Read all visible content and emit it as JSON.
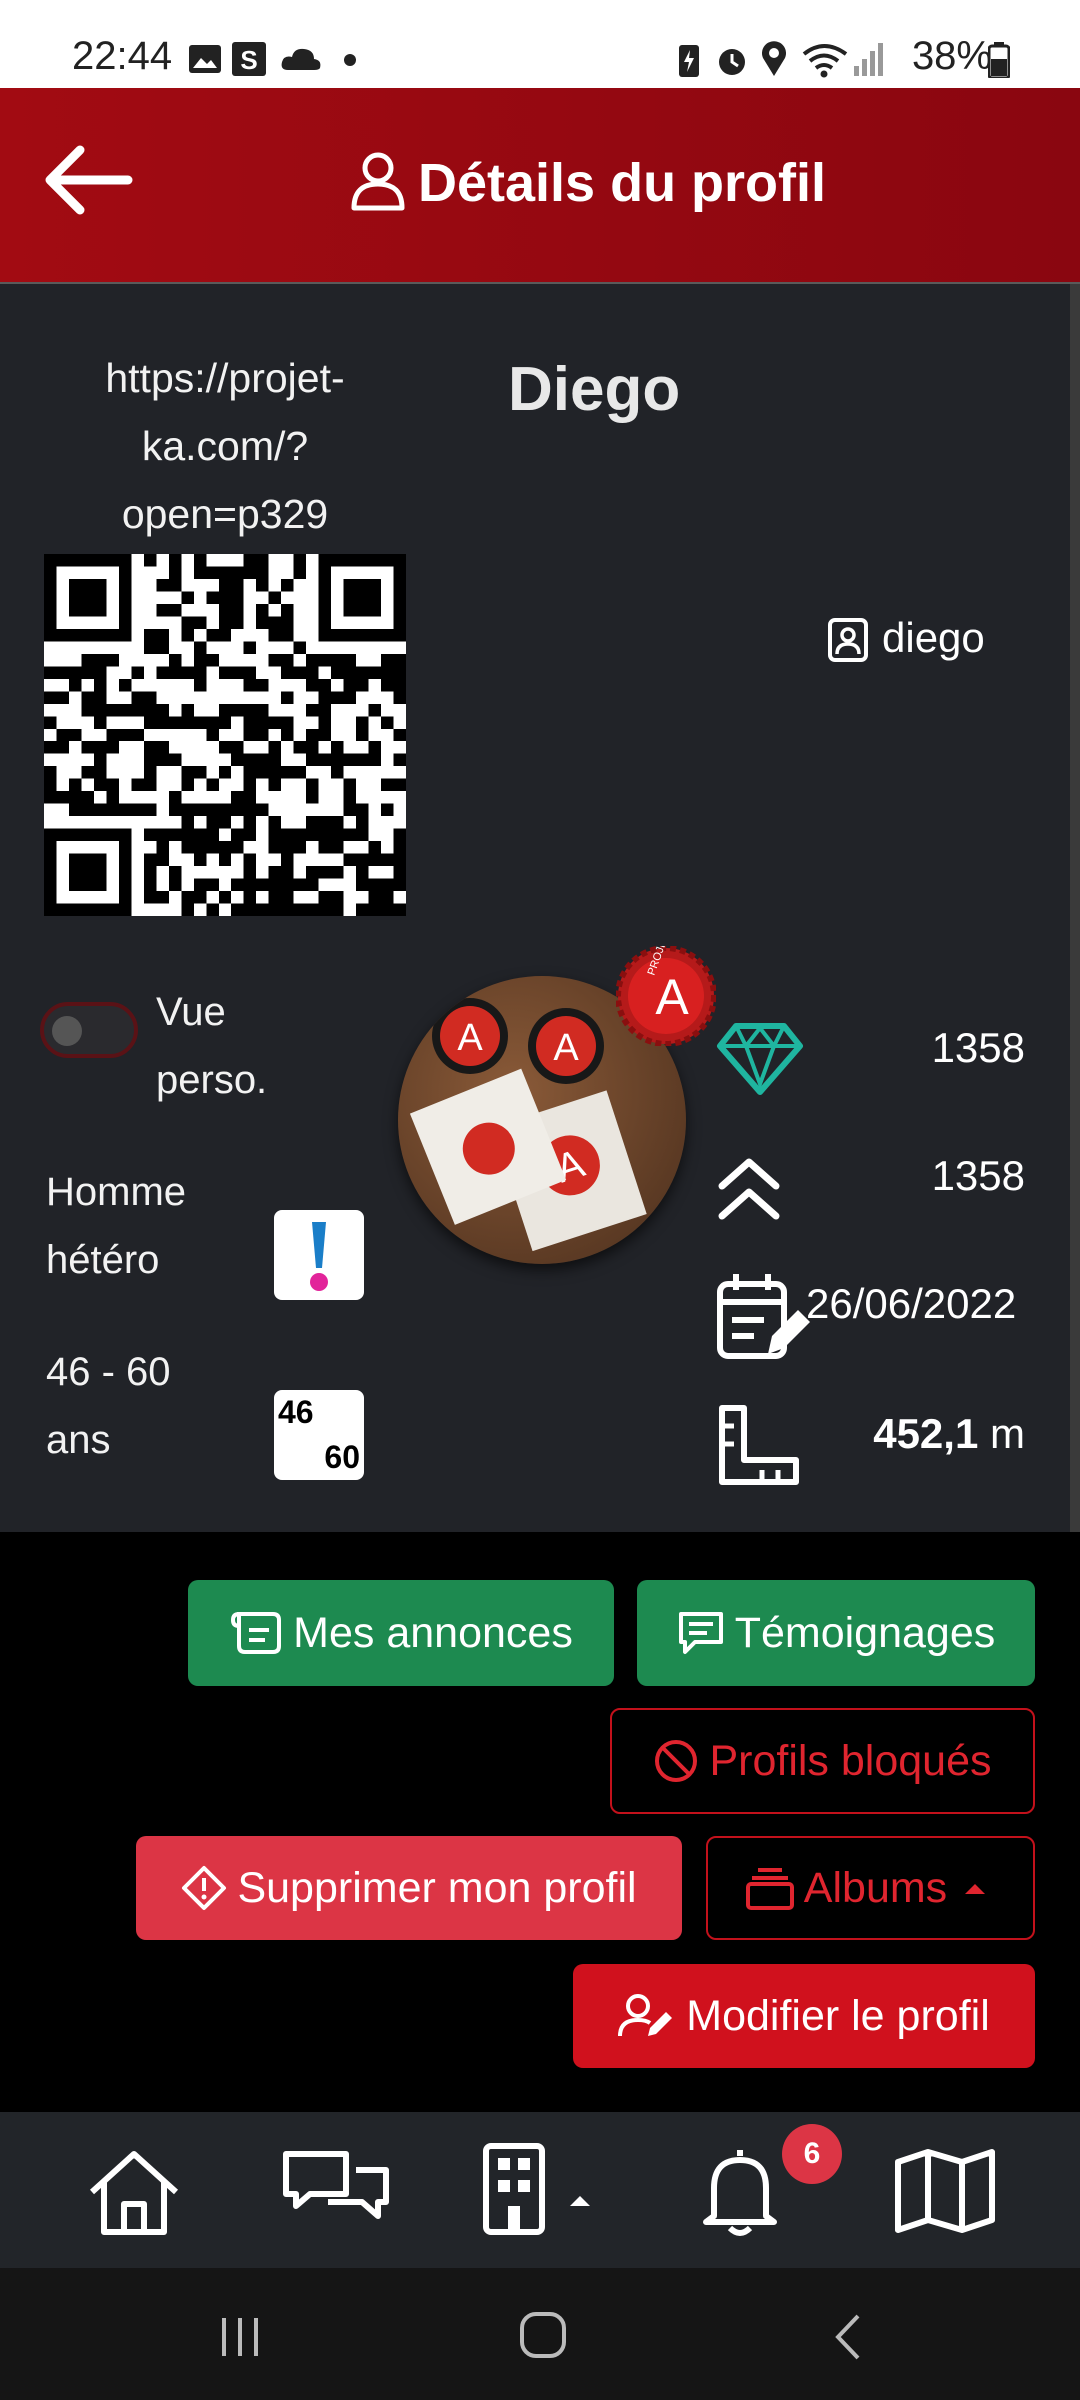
{
  "status_bar": {
    "time": "22:44",
    "battery": "38%"
  },
  "header": {
    "title": "Détails du profil"
  },
  "profile": {
    "url_line1": "https://projet-",
    "url_line2": "ka.com/?",
    "url_line3": "open=p329",
    "name": "Diego",
    "username": "diego",
    "toggle_label_1": "Vue",
    "toggle_label_2": "perso.",
    "orientation_1": "Homme",
    "orientation_2": "hétéro",
    "age_1": "46 - 60",
    "age_2": "ans",
    "age_badge_top": "46",
    "age_badge_bottom": "60",
    "badge_letter": "A",
    "badge_ring_text": "PROJET",
    "stats": {
      "diamonds": "1358",
      "level": "1358",
      "date": "26/06/2022",
      "distance_value": "452,1",
      "distance_unit": "m"
    }
  },
  "buttons": {
    "announcements": "Mes annonces",
    "testimonials": "Témoignages",
    "blocked": "Profils bloqués",
    "delete": "Supprimer mon profil",
    "albums": "Albums",
    "edit": "Modifier le profil"
  },
  "bottom_nav": {
    "notification_count": "6"
  },
  "colors": {
    "header": "#a20b12",
    "green": "#1d8a50",
    "danger": "#dc3545",
    "teal": "#1fb5a0"
  }
}
